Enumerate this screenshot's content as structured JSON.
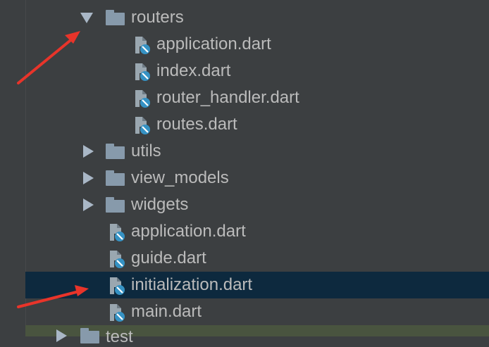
{
  "tree": {
    "routers": {
      "label": "routers"
    },
    "routers_files": [
      {
        "label": "application.dart"
      },
      {
        "label": "index.dart"
      },
      {
        "label": "router_handler.dart"
      },
      {
        "label": "routes.dart"
      }
    ],
    "folders": [
      {
        "label": "utils"
      },
      {
        "label": "view_models"
      },
      {
        "label": "widgets"
      }
    ],
    "files": [
      {
        "label": "application.dart"
      },
      {
        "label": "guide.dart"
      },
      {
        "label": "initialization.dart"
      },
      {
        "label": "main.dart"
      }
    ],
    "partial_bottom": {
      "label": "test"
    }
  },
  "colors": {
    "background": "#3c3f41",
    "selection": "#0d293e",
    "text": "#bbbbbb",
    "folder": "#879aab",
    "annotation_arrow": "#e8342a"
  }
}
